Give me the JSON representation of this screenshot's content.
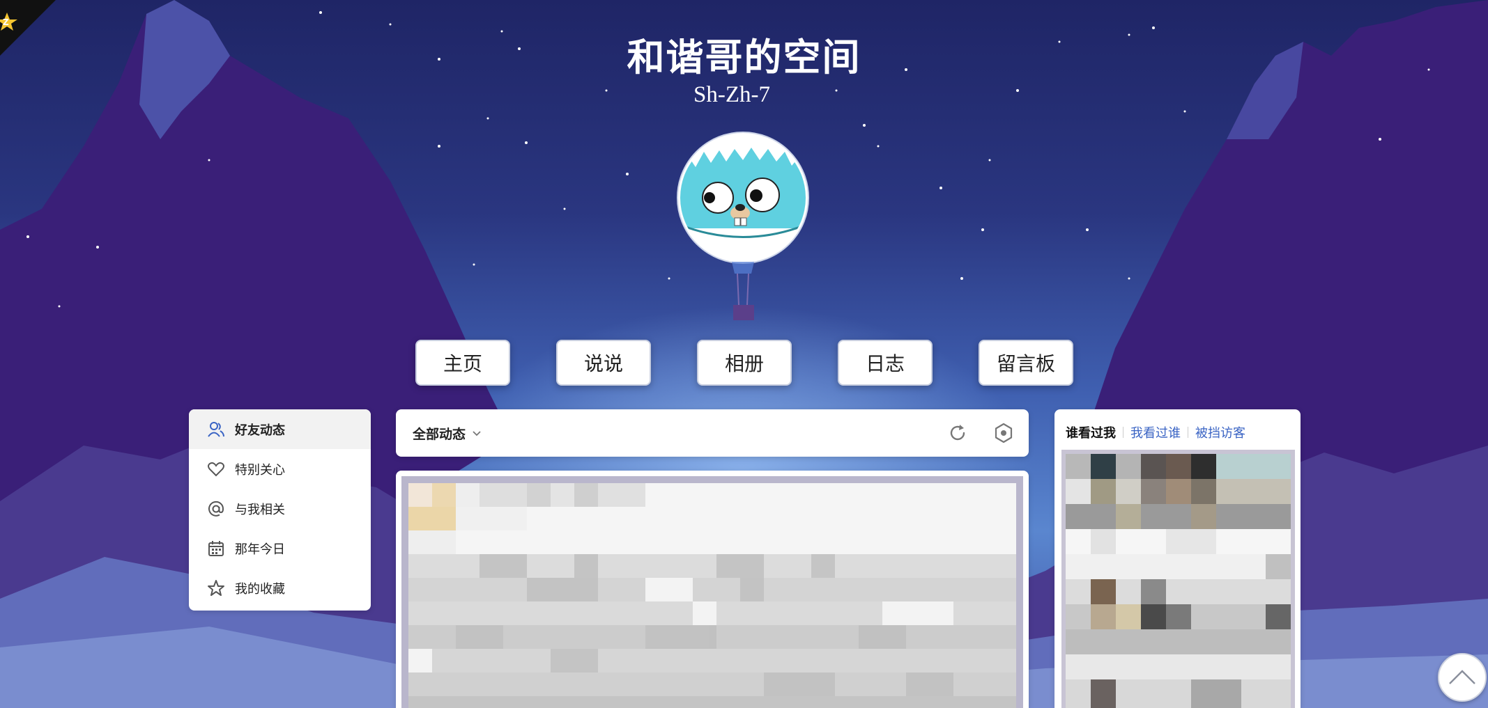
{
  "site": {
    "title": "和谐哥的空间",
    "subtitle": "Sh-Zh-7"
  },
  "nav": {
    "items": [
      {
        "label": "主页"
      },
      {
        "label": "说说"
      },
      {
        "label": "相册"
      },
      {
        "label": "日志"
      },
      {
        "label": "留言板"
      }
    ]
  },
  "sidebar": {
    "items": [
      {
        "label": "好友动态",
        "icon": "friends-icon",
        "active": true
      },
      {
        "label": "特别关心",
        "icon": "heart-icon"
      },
      {
        "label": "与我相关",
        "icon": "at-icon"
      },
      {
        "label": "那年今日",
        "icon": "calendar-icon"
      },
      {
        "label": "我的收藏",
        "icon": "star-icon"
      }
    ]
  },
  "feed": {
    "filter_label": "全部动态",
    "filter_icon": "chevron-down-icon",
    "refresh_icon": "refresh-icon",
    "settings_icon": "settings-icon"
  },
  "visitors": {
    "tabs": [
      {
        "label": "谁看过我",
        "active": true
      },
      {
        "label": "我看过谁"
      },
      {
        "label": "被挡访客"
      }
    ]
  },
  "colors": {
    "accent_link": "#3a64c4",
    "sky_top": "#1f2566",
    "mountain": "#3a237a",
    "avatar_face": "#5fd0e0"
  }
}
